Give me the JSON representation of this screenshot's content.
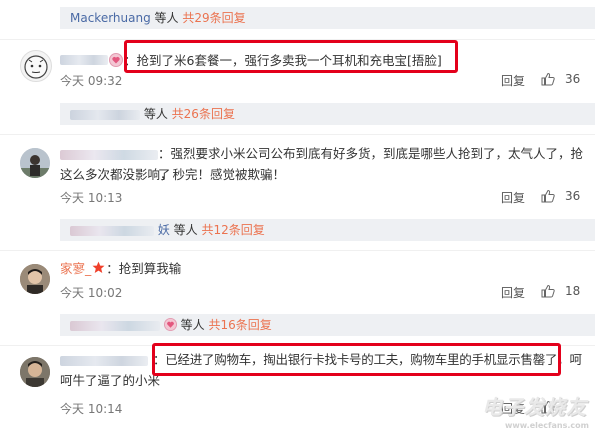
{
  "top_bar": {
    "user": "Mackerhuang",
    "suffix": "等人",
    "link": "共29条回复"
  },
  "comments": [
    {
      "text": "：抢到了米6套餐一，强行多卖我一个耳机和充电宝[捂脸]",
      "time": "今天 09:32",
      "reply_label": "回复",
      "likes": "36",
      "sub_suffix": "等人",
      "sub_link": "共26条回复"
    },
    {
      "text_line1": "：强烈要求小米公司公布到底有好多货，到底是哪些人抢到了，太气人了，抢了",
      "text_line2": "这么多次都没影响，秒完！感觉被欺骗！",
      "time": "今天 10:13",
      "reply_label": "回复",
      "likes": "36",
      "sub_partial": "妖",
      "sub_suffix": "等人",
      "sub_link": "共12条回复"
    },
    {
      "username": "家寥_",
      "text": "：抢到算我输",
      "time": "今天 10:02",
      "reply_label": "回复",
      "likes": "18",
      "sub_suffix": "等人",
      "sub_link": "共16条回复"
    },
    {
      "text_line1": "：已经进了购物车，掏出银行卡找卡号的工夫，购物车里的手机显示售罄了，呵",
      "text_line2": "呵牛了逼了的小米",
      "time": "今天 10:14",
      "reply_label": "回复"
    }
  ],
  "watermark": {
    "brand": "电子发烧友",
    "url": "www.elecfans.com"
  },
  "colors": {
    "highlight": "#e3001b",
    "link": "#eb7350",
    "user": "#4a6aa5",
    "sub_bar": "#eef0f3"
  }
}
